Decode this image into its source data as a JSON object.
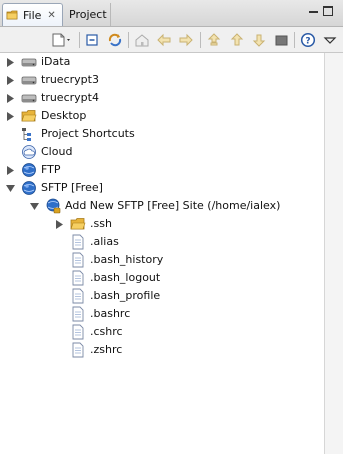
{
  "tabs": [
    {
      "label": "File",
      "active": true
    },
    {
      "label": "Project",
      "active": false
    }
  ],
  "colors": {
    "folder": "#e8b43a",
    "disk": "#8c8c8c",
    "globe": "#2f6fc9",
    "accent": "#3a73c8"
  },
  "toolbar_icons": [
    "new-menu-icon",
    "collapse-all-icon",
    "sync-icon",
    "home-icon",
    "back-icon",
    "forward-icon",
    "up-folder-icon",
    "upload-icon",
    "download-icon",
    "stop-icon",
    "help-icon",
    "view-menu-icon"
  ],
  "tree": {
    "items": [
      {
        "label": "iData",
        "icon": "disk-icon",
        "expanded": false,
        "level": 0
      },
      {
        "label": "truecrypt3",
        "icon": "disk-icon",
        "expanded": false,
        "level": 0
      },
      {
        "label": "truecrypt4",
        "icon": "disk-icon",
        "expanded": false,
        "level": 0
      },
      {
        "label": "Desktop",
        "icon": "folder-icon",
        "expanded": false,
        "level": 0
      },
      {
        "label": "Project Shortcuts",
        "icon": "shortcuts-icon",
        "expanded": null,
        "level": 0
      },
      {
        "label": "Cloud",
        "icon": "cloud-icon",
        "expanded": null,
        "level": 0
      },
      {
        "label": "FTP",
        "icon": "globe-icon",
        "expanded": false,
        "level": 0
      },
      {
        "label": "SFTP [Free]",
        "icon": "globe-icon",
        "expanded": true,
        "level": 0
      },
      {
        "label": "Add New SFTP [Free] Site (/home/ialex)",
        "icon": "globe-add-icon",
        "expanded": true,
        "level": 1
      },
      {
        "label": ".ssh",
        "icon": "folder-icon",
        "expanded": false,
        "level": 2
      },
      {
        "label": ".alias",
        "icon": "file-icon",
        "expanded": null,
        "level": 2
      },
      {
        "label": ".bash_history",
        "icon": "file-icon",
        "expanded": null,
        "level": 2
      },
      {
        "label": ".bash_logout",
        "icon": "file-icon",
        "expanded": null,
        "level": 2
      },
      {
        "label": ".bash_profile",
        "icon": "file-icon",
        "expanded": null,
        "level": 2
      },
      {
        "label": ".bashrc",
        "icon": "file-icon",
        "expanded": null,
        "level": 2
      },
      {
        "label": ".cshrc",
        "icon": "file-icon",
        "expanded": null,
        "level": 2
      },
      {
        "label": ".zshrc",
        "icon": "file-icon",
        "expanded": null,
        "level": 2
      }
    ]
  }
}
